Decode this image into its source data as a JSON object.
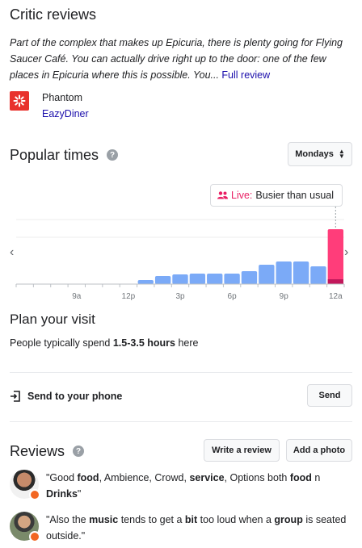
{
  "critic": {
    "title": "Critic reviews",
    "quote": "Part of the complex that makes up Epicuria, there is plenty going for Flying Saucer Café. You can actually drive right up to the door: one of the few places in Epicuria where this is possible. You...",
    "full_review_link": "Full review",
    "reviewer": "Phantom",
    "source": "EazyDiner"
  },
  "popular_times": {
    "title": "Popular times",
    "day": "Mondays",
    "live_label": "Live:",
    "live_text": "Busier than usual",
    "tick_labels": [
      "9a",
      "12p",
      "3p",
      "6p",
      "9p",
      "12a"
    ]
  },
  "chart_data": {
    "type": "bar",
    "categories": [
      "6a",
      "7a",
      "8a",
      "9a",
      "10a",
      "11a",
      "12p",
      "1p",
      "2p",
      "3p",
      "4p",
      "5p",
      "6p",
      "7p",
      "8p",
      "9p",
      "10p",
      "11p",
      "12a"
    ],
    "values": [
      0,
      0,
      0,
      0,
      0,
      0,
      0,
      5,
      10,
      12,
      13,
      13,
      13,
      16,
      24,
      28,
      28,
      22,
      68
    ],
    "live_value": 68,
    "live_index": 18,
    "ylim": [
      0,
      100
    ],
    "colors": {
      "bar": "#7baaf7",
      "live": "#ff3d7a",
      "live_usual": "#c2185b",
      "axis": "#9aa0a6"
    }
  },
  "plan": {
    "title": "Plan your visit",
    "text_prefix": "People typically spend ",
    "duration": "1.5-3.5 hours",
    "text_suffix": " here"
  },
  "send": {
    "label": "Send to your phone",
    "button": "Send"
  },
  "reviews": {
    "title": "Reviews",
    "write_button": "Write a review",
    "photo_button": "Add a photo",
    "items": [
      {
        "segments": [
          {
            "t": "\"Good ",
            "b": false
          },
          {
            "t": "food",
            "b": true
          },
          {
            "t": ", Ambience, Crowd, ",
            "b": false
          },
          {
            "t": "service",
            "b": true
          },
          {
            "t": ", Options both ",
            "b": false
          },
          {
            "t": "food",
            "b": true
          },
          {
            "t": " n ",
            "b": false
          },
          {
            "t": "Drinks",
            "b": true
          },
          {
            "t": "\"",
            "b": false
          }
        ]
      },
      {
        "segments": [
          {
            "t": "\"Also the ",
            "b": false
          },
          {
            "t": "music",
            "b": true
          },
          {
            "t": " tends to get a ",
            "b": false
          },
          {
            "t": "bit",
            "b": true
          },
          {
            "t": " too loud when a ",
            "b": false
          },
          {
            "t": "group",
            "b": true
          },
          {
            "t": " is seated outside.\"",
            "b": false
          }
        ]
      }
    ]
  }
}
